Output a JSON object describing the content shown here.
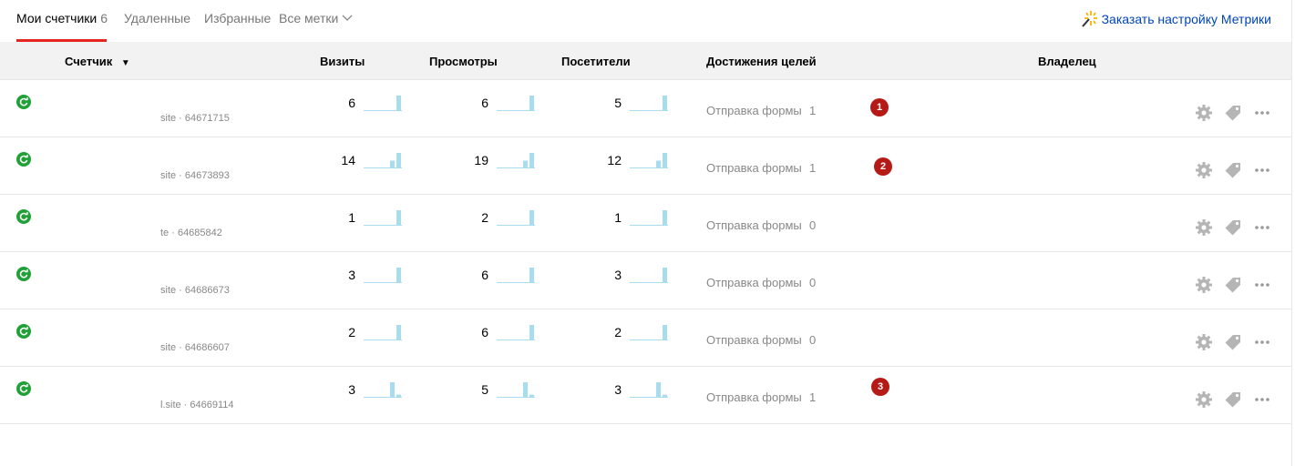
{
  "nav": {
    "tabs": [
      {
        "label": "Мои счетчики",
        "count": "6"
      },
      {
        "label": "Удаленные"
      },
      {
        "label": "Избранные"
      }
    ],
    "tags_label": "Все метки",
    "order_label": "Заказать настройку Метрики"
  },
  "table": {
    "headers": {
      "counter": "Счетчик",
      "sort_arrow": "▼",
      "visits": "Визиты",
      "views": "Просмотры",
      "visitors": "Посетители",
      "goals": "Достижения целей",
      "owner": "Владелец"
    },
    "rows": [
      {
        "sub": "site · 64671715",
        "visits": "6",
        "views": "6",
        "visitors": "5",
        "goal": "Отправка формы",
        "goal_value": "1",
        "badge": "1",
        "visits_trend": [
          0,
          0,
          0,
          0,
          0,
          1
        ],
        "views_trend": [
          0,
          0,
          0,
          0,
          0,
          1
        ],
        "visitors_trend": [
          0,
          0,
          0,
          0,
          0,
          1
        ]
      },
      {
        "sub": "site · 64673893",
        "visits": "14",
        "views": "19",
        "visitors": "12",
        "goal": "Отправка формы",
        "goal_value": "1",
        "badge": "2",
        "visits_trend": [
          0,
          0,
          0,
          0,
          0.5,
          1
        ],
        "views_trend": [
          0,
          0,
          0,
          0,
          0.5,
          1
        ],
        "visitors_trend": [
          0,
          0,
          0,
          0,
          0.5,
          1
        ]
      },
      {
        "sub": "te · 64685842",
        "visits": "1",
        "views": "2",
        "visitors": "1",
        "goal": "Отправка формы",
        "goal_value": "0",
        "badge": "",
        "visits_trend": [
          0,
          0,
          0,
          0,
          0,
          1
        ],
        "views_trend": [
          0,
          0,
          0,
          0,
          0,
          1
        ],
        "visitors_trend": [
          0,
          0,
          0,
          0,
          0,
          1
        ]
      },
      {
        "sub": "site · 64686673",
        "visits": "3",
        "views": "6",
        "visitors": "3",
        "goal": "Отправка формы",
        "goal_value": "0",
        "badge": "",
        "visits_trend": [
          0,
          0,
          0,
          0,
          0,
          1
        ],
        "views_trend": [
          0,
          0,
          0,
          0,
          0,
          1
        ],
        "visitors_trend": [
          0,
          0,
          0,
          0,
          0,
          1
        ]
      },
      {
        "sub": "site · 64686607",
        "visits": "2",
        "views": "6",
        "visitors": "2",
        "goal": "Отправка формы",
        "goal_value": "0",
        "badge": "",
        "visits_trend": [
          0,
          0,
          0,
          0,
          0,
          1
        ],
        "views_trend": [
          0,
          0,
          0,
          0,
          0,
          1
        ],
        "visitors_trend": [
          0,
          0,
          0,
          0,
          0,
          1
        ]
      },
      {
        "sub": "l.site · 64669114",
        "visits": "3",
        "views": "5",
        "visitors": "3",
        "goal": "Отправка формы",
        "goal_value": "1",
        "badge": "3",
        "visits_trend": [
          0,
          0,
          0,
          0,
          1,
          0.2
        ],
        "views_trend": [
          0,
          0,
          0,
          0,
          1,
          0.2
        ],
        "visitors_trend": [
          0,
          0,
          0,
          0,
          1,
          0.2
        ]
      }
    ]
  },
  "icons": {
    "status": "refresh-icon",
    "settings": "gear-icon",
    "tags": "tag-icon",
    "more": "more-dots-icon",
    "order": "magic-wand-icon",
    "dropdown": "chevron-down-icon"
  },
  "colors": {
    "accent": "#e52620",
    "link": "#0044bb",
    "status_ok": "#21a038",
    "badge": "#b61a16",
    "spark": "#a8ddf0"
  }
}
